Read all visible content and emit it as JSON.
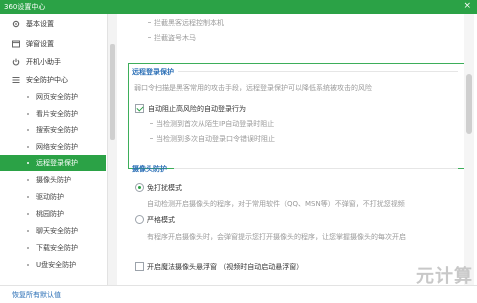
{
  "window": {
    "title": "360设置中心",
    "close_glyph": "×"
  },
  "sidebar": {
    "top_items": [
      {
        "label": "基本设置",
        "icon": "gear-icon"
      },
      {
        "label": "弹窗设置",
        "icon": "popup-window-icon"
      },
      {
        "label": "开机小助手",
        "icon": "power-icon"
      },
      {
        "label": "安全防护中心",
        "icon": "shield-list-icon"
      }
    ],
    "sub_items": [
      "网页安全防护",
      "看片安全防护",
      "搜索安全防护",
      "网络安全防护",
      "远程登录保护",
      "摄像头防护",
      "驱动防护",
      "桃园防护",
      "聊天安全防护",
      "下载安全防护",
      "U盘安全防护"
    ],
    "active_sub": "远程登录保护"
  },
  "content": {
    "top_hints": [
      "拦截黑客远程控制本机",
      "拦截盗号木马"
    ],
    "remote_login": {
      "title": "远程登录保护",
      "description": "弱口令扫描是黑客常用的攻击手段，远程登录保护可以降低系统被攻击的风险",
      "checkbox_label": "自动阻止高风险的自动登录行为",
      "checked": true,
      "hints": [
        "当检测到首次从陌生IP自动登录时阻止",
        "当检测到多次自动登录口令错误时阻止"
      ]
    },
    "camera": {
      "title": "摄像头防护",
      "mode_free": {
        "label": "免打扰模式",
        "selected": true,
        "desc": "自动检测开启摄像头的程序，对于常用软件（QQ、MSN等）不弹窗，不打扰您视频"
      },
      "mode_strict": {
        "label": "严格模式",
        "selected": false,
        "desc": "有程序开启摄像头时，会弹窗提示您打开摄像头的程序，让您掌握摄像头的每次开启"
      },
      "float_checkbox_label": "开启魔法摄像头悬浮窗 （视频时自动启动悬浮窗）",
      "float_checked": false
    }
  },
  "footer": {
    "restore_label": "恢复所有默认值"
  },
  "watermark": "元计算"
}
